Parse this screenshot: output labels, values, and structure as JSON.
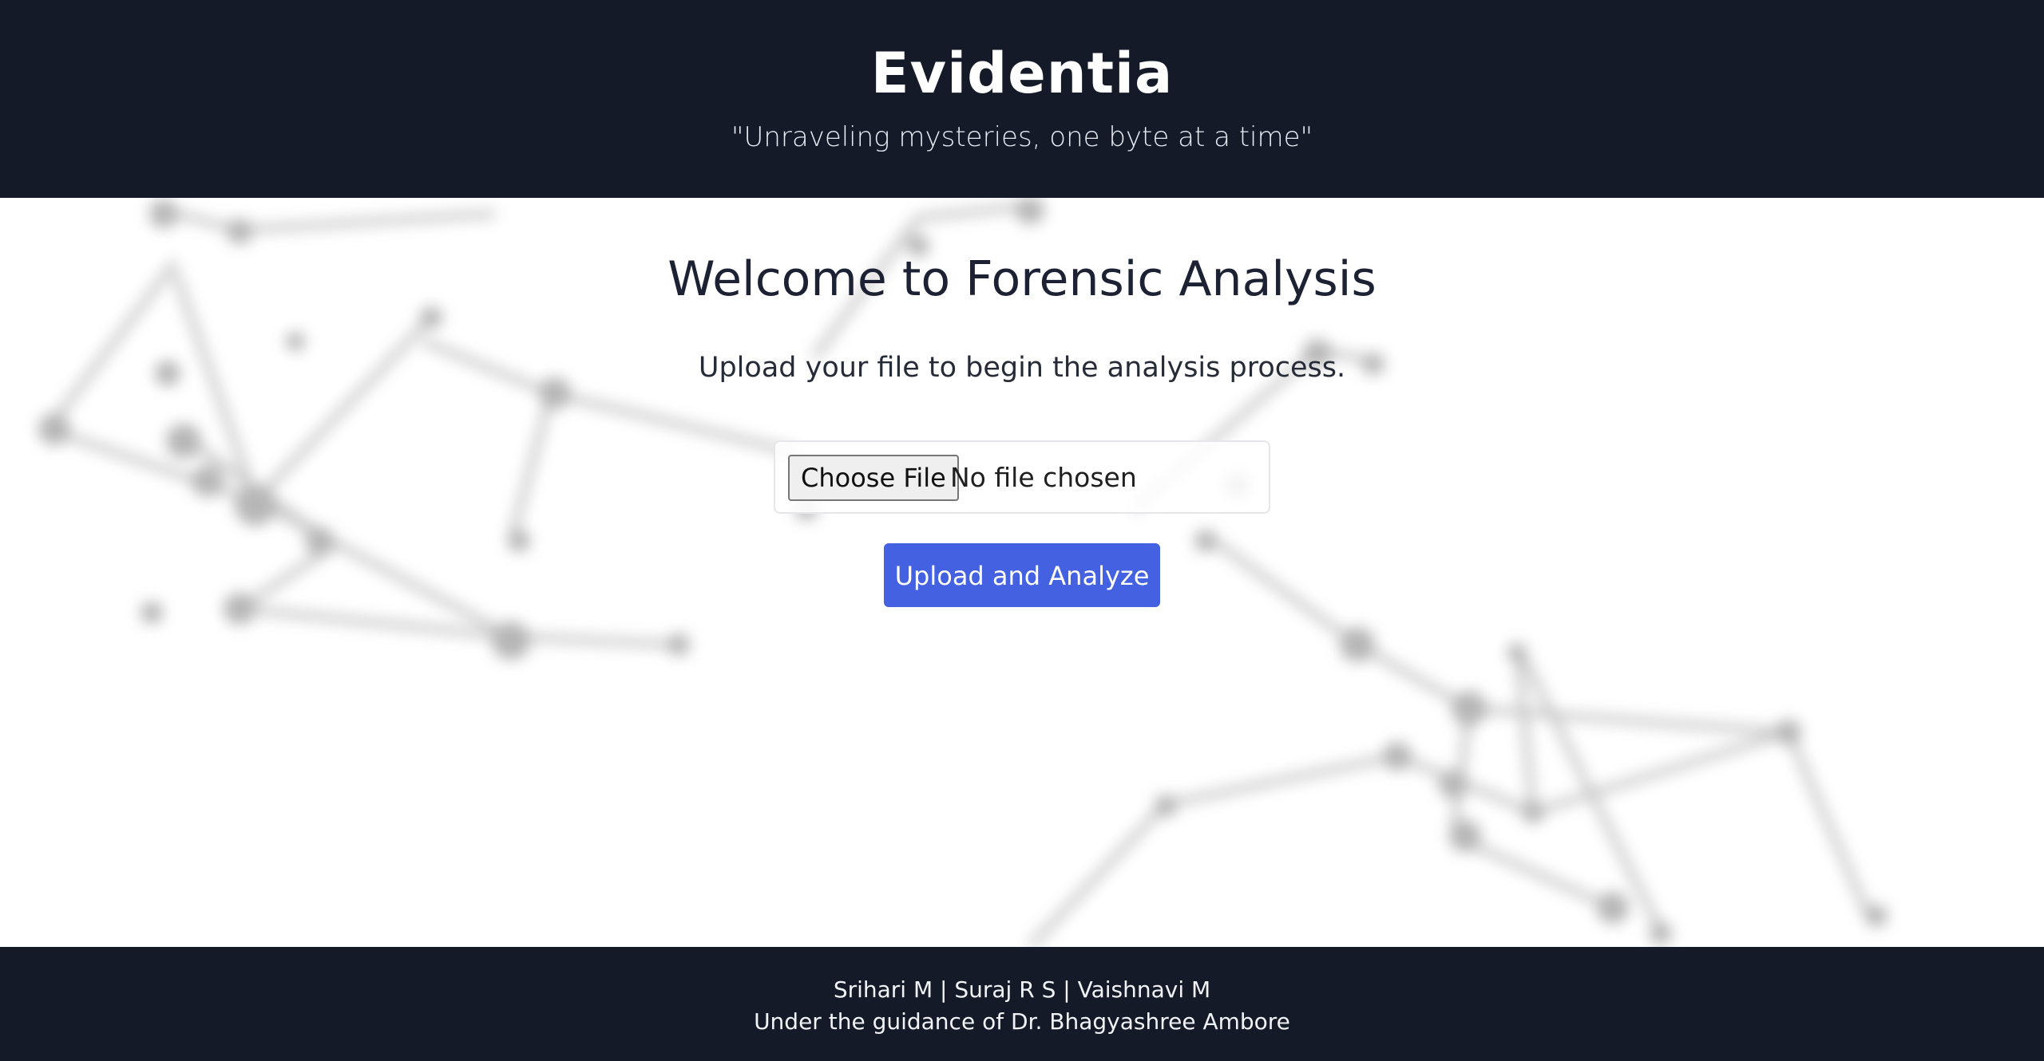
{
  "header": {
    "brand": "Evidentia",
    "tagline": "\"Unraveling mysteries, one byte at a time\""
  },
  "main": {
    "title": "Welcome to Forensic Analysis",
    "instructions": "Upload your file to begin the analysis process.",
    "file_input": {
      "button_label": "Choose File",
      "status": "No file chosen"
    },
    "submit_label": "Upload and Analyze"
  },
  "footer": {
    "authors": "Srihari M | Suraj R S | Vaishnavi M",
    "guidance": "Under the guidance of Dr. Bhagyashree Ambore"
  },
  "colors": {
    "header_bg": "#141a28",
    "accent": "#4361e0",
    "text_dark": "#1c2233"
  }
}
